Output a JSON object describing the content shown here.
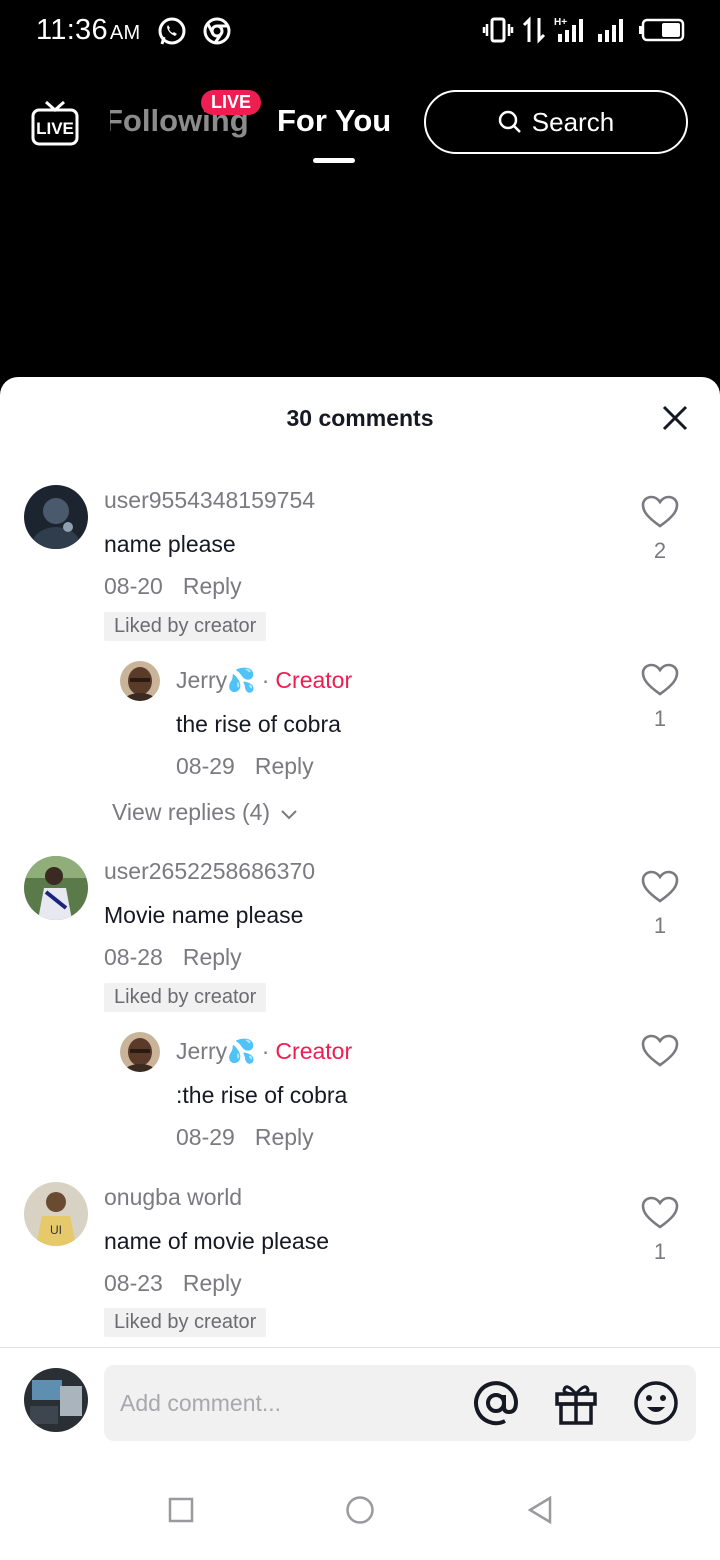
{
  "status_bar": {
    "time": "11:36",
    "ampm": "AM"
  },
  "nav": {
    "tab_following": "Following",
    "live_badge": "LIVE",
    "tab_for_you": "For You",
    "search_label": "Search",
    "live_tv_label": "LIVE"
  },
  "sheet": {
    "title": "30 comments",
    "comments": [
      {
        "username": "user9554348159754",
        "text": "name please",
        "date": "08-20",
        "reply_label": "Reply",
        "liked_badge": "Liked by creator",
        "likes": "2",
        "reply": {
          "username": "Jerry💦",
          "tag": "Creator",
          "text": "the rise of cobra",
          "date": "08-29",
          "reply_label": "Reply",
          "likes": "1"
        },
        "view_replies": "View replies (4)"
      },
      {
        "username": "user2652258686370",
        "text": "Movie name please",
        "date": "08-28",
        "reply_label": "Reply",
        "liked_badge": "Liked by creator",
        "likes": "1",
        "reply": {
          "username": "Jerry💦",
          "tag": "Creator",
          "text": ":the rise of cobra",
          "date": "08-29",
          "reply_label": "Reply",
          "likes": ""
        }
      },
      {
        "username": "onugba world",
        "text": "name of movie please",
        "date": "08-23",
        "reply_label": "Reply",
        "liked_badge": "Liked by creator",
        "likes": "1"
      }
    ]
  },
  "composer": {
    "placeholder": "Add comment..."
  },
  "colors": {
    "accent": "#ee1d52",
    "text": "#161823",
    "muted": "#7a7a80"
  },
  "icons": [
    "whatsapp-icon",
    "chrome-icon",
    "vibrate-icon",
    "data-arrows-icon",
    "signal-icon",
    "battery-icon",
    "live-tv-icon",
    "search-icon",
    "close-icon",
    "heart-icon",
    "chevron-down-icon",
    "at-icon",
    "gift-icon",
    "emoji-icon",
    "square-nav-icon",
    "circle-nav-icon",
    "back-triangle-icon"
  ]
}
